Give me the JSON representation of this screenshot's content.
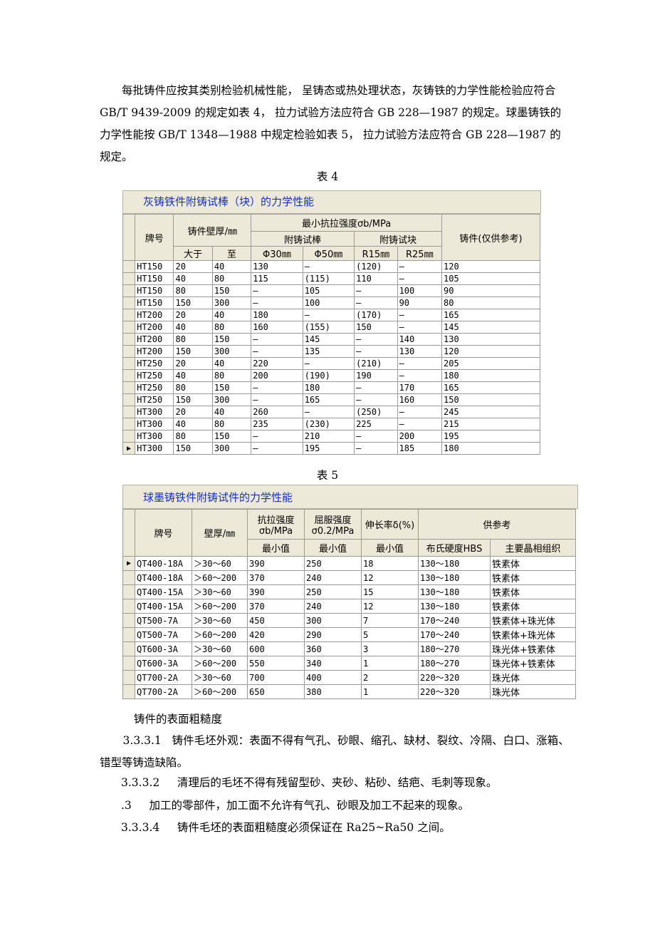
{
  "intro": "每批铸件应按其类别检验机械性能， 呈铸态或热处理状态，灰铸铁的力学性能检验应符合 GB/T 9439-2009 的规定如表 4， 拉力试验方法应符合 GB 228—1987 的规定。球墨铸铁的力学性能按 GB/T 1348—1988 中规定检验如表 5， 拉力试验方法应符合 GB 228—1987 的规定。",
  "table4": {
    "caption": "表 4",
    "title": "灰铸铁件附铸试棒（块）的力学性能",
    "headers": {
      "grade": "牌号",
      "thickness": "铸件壁厚/㎜",
      "over": "大于",
      "to": "至",
      "min_strength": "最小抗拉强度σb/MPa",
      "bar": "附铸试棒",
      "block": "附铸试块",
      "casting": "铸件(仅供参考)",
      "phi30": "Φ30㎜",
      "phi50": "Φ50㎜",
      "r15": "R15㎜",
      "r25": "R25㎜"
    },
    "rows": [
      [
        "HT150",
        "20",
        "40",
        "130",
        "—",
        "(120)",
        "—",
        "120"
      ],
      [
        "HT150",
        "40",
        "80",
        "115",
        "(115)",
        "110",
        "—",
        "105"
      ],
      [
        "HT150",
        "80",
        "150",
        "—",
        "105",
        "—",
        "100",
        "90"
      ],
      [
        "HT150",
        "150",
        "300",
        "—",
        "100",
        "—",
        "90",
        "80"
      ],
      [
        "HT200",
        "20",
        "40",
        "180",
        "—",
        "(170)",
        "—",
        "165"
      ],
      [
        "HT200",
        "40",
        "80",
        "160",
        "(155)",
        "150",
        "—",
        "145"
      ],
      [
        "HT200",
        "80",
        "150",
        "—",
        "145",
        "—",
        "140",
        "130"
      ],
      [
        "HT200",
        "150",
        "300",
        "—",
        "135",
        "—",
        "130",
        "120"
      ],
      [
        "HT250",
        "20",
        "40",
        "220",
        "—",
        "(210)",
        "—",
        "205"
      ],
      [
        "HT250",
        "40",
        "80",
        "200",
        "(190)",
        "190",
        "—",
        "180"
      ],
      [
        "HT250",
        "80",
        "150",
        "—",
        "180",
        "—",
        "170",
        "165"
      ],
      [
        "HT250",
        "150",
        "300",
        "—",
        "165",
        "—",
        "160",
        "150"
      ],
      [
        "HT300",
        "20",
        "40",
        "260",
        "—",
        "(250)",
        "—",
        "245"
      ],
      [
        "HT300",
        "40",
        "80",
        "235",
        "(230)",
        "225",
        "—",
        "215"
      ],
      [
        "HT300",
        "80",
        "150",
        "—",
        "210",
        "—",
        "200",
        "195"
      ],
      [
        "HT300",
        "150",
        "300",
        "—",
        "195",
        "—",
        "185",
        "180"
      ]
    ]
  },
  "table5": {
    "caption": "表 5",
    "title": "球墨铸铁件附铸试件的力学性能",
    "headers": {
      "grade": "牌号",
      "thickness": "壁厚/㎜",
      "tensile": "抗拉强度σb/MPa",
      "yield": "屈服强度σ0.2/MPa",
      "elong": "伸长率δ(%)",
      "ref": "供参考",
      "min1": "最小值",
      "min2": "最小值",
      "min3": "最小值",
      "hbs": "布氏硬度HBS",
      "micro": "主要晶相组织"
    },
    "rows": [
      [
        "QT400-18A",
        "＞30～60",
        "390",
        "250",
        "18",
        "130～180",
        "铁素体"
      ],
      [
        "QT400-18A",
        "＞60～200",
        "370",
        "240",
        "12",
        "130～180",
        "铁素体"
      ],
      [
        "QT400-15A",
        "＞30～60",
        "390",
        "250",
        "15",
        "130～180",
        "铁素体"
      ],
      [
        "QT400-15A",
        "＞60～200",
        "370",
        "240",
        "12",
        "130～180",
        "铁素体"
      ],
      [
        "QT500-7A",
        "＞30～60",
        "450",
        "300",
        "7",
        "170～240",
        "铁素体+珠光体"
      ],
      [
        "QT500-7A",
        "＞60～200",
        "420",
        "290",
        "5",
        "170～240",
        "铁素体+珠光体"
      ],
      [
        "QT600-3A",
        "＞30～60",
        "600",
        "360",
        "3",
        "180～270",
        "珠光体+铁素体"
      ],
      [
        "QT600-3A",
        "＞60～200",
        "550",
        "340",
        "1",
        "180～270",
        "珠光体+铁素体"
      ],
      [
        "QT700-2A",
        "＞30～60",
        "700",
        "400",
        "2",
        "220～320",
        "珠光体"
      ],
      [
        "QT700-2A",
        "＞60～200",
        "650",
        "380",
        "1",
        "220～320",
        "珠光体"
      ]
    ]
  },
  "section_title": "铸件的表面粗糙度",
  "items": [
    {
      "num": "3.3.3.1",
      "text": "铸件毛坯外观：表面不得有气孔、砂眼、缩孔、缺材、裂纹、冷隔、白口、涨箱、错型等铸造缺陷。"
    },
    {
      "num": "3.3.3.2",
      "text": "清理后的毛坯不得有残留型砂、夹砂、粘砂、结疤、毛刺等现象。"
    },
    {
      "num": ".3",
      "text": "加工的零部件，加工面不允许有气孔、砂眼及加工不起来的现象。"
    },
    {
      "num": "3.3.3.4",
      "text": "铸件毛坯的表面粗糙度必须保证在 Ra25~Ra50 之间。"
    }
  ]
}
